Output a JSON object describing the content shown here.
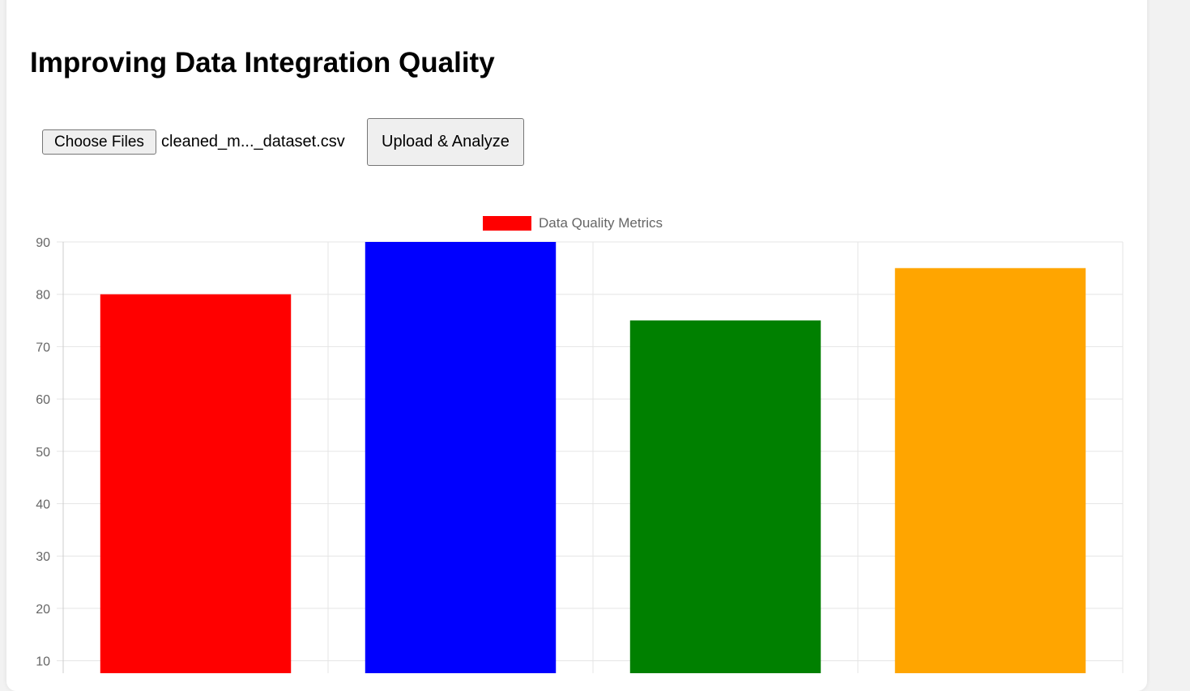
{
  "page": {
    "title": "Improving Data Integration Quality"
  },
  "upload": {
    "choose_label": "Choose Files",
    "file_name": "cleaned_m..._dataset.csv",
    "upload_label": "Upload & Analyze"
  },
  "chart_data": {
    "type": "bar",
    "legend": [
      {
        "label": "Data Quality Metrics",
        "color": "#ff0000"
      }
    ],
    "legend_position": "top",
    "series": [
      {
        "name": "Data Quality Metrics",
        "values": [
          80,
          90,
          75,
          85
        ],
        "colors": [
          "#ff0000",
          "#0000ff",
          "#008000",
          "#ffa500"
        ]
      }
    ],
    "y_ticks": [
      90,
      80,
      70,
      60,
      50,
      40,
      30,
      20,
      10
    ],
    "ylim": [
      0,
      90
    ],
    "grid": true
  }
}
